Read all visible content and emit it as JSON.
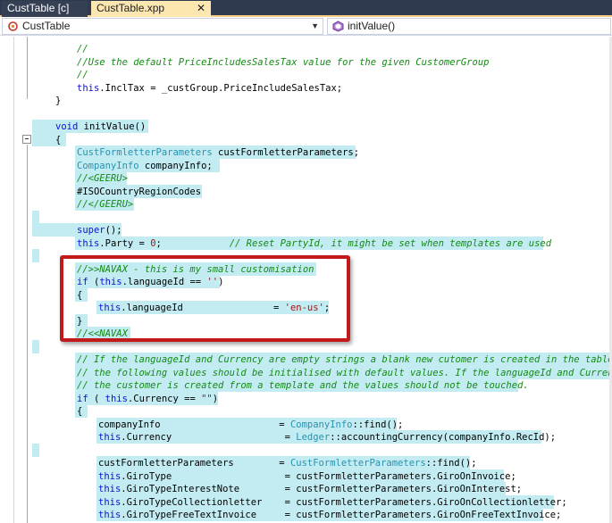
{
  "tabs": [
    {
      "label": "CustTable [c]",
      "active": false
    },
    {
      "label": "CustTable.xpp",
      "active": true,
      "close": "✕"
    }
  ],
  "nav": {
    "class_combo": "CustTable",
    "method_combo": "initValue()",
    "arrow": "▼"
  },
  "colors": {
    "keyword": "#1010d8",
    "comment": "#148a14",
    "type": "#2b91af",
    "string": "#a31515",
    "highlight": "#c2ecf2",
    "annotation_border": "#c21a1a",
    "active_tab": "#fde7b0",
    "tabbar": "#2f3a4f"
  },
  "icons": {
    "class_combo": "class-icon",
    "method_combo": "method-icon",
    "outline_toggle": "collapse-minus-icon"
  },
  "code_lines": [
    [
      {
        "cls": "c",
        "t": "//"
      }
    ],
    [
      {
        "cls": "c",
        "t": "//Use the default PriceIncludesSalesTax value for the given CustomerGroup"
      }
    ],
    [
      {
        "cls": "c",
        "t": "//"
      }
    ],
    [
      {
        "cls": "k",
        "t": "this"
      },
      {
        "cls": "p",
        "t": ".InclTax = _custGroup.PriceIncludeSalesTax;"
      }
    ],
    [
      {
        "cls": "p",
        "t": "}"
      }
    ],
    [
      {
        "cls": "p",
        "t": ""
      }
    ],
    [
      {
        "cls": "k",
        "t": "void"
      },
      {
        "cls": "p",
        "t": " initValue()"
      }
    ],
    [
      {
        "cls": "p",
        "t": "{"
      }
    ],
    [
      {
        "cls": "t",
        "t": "CustFormletterParameters"
      },
      {
        "cls": "p",
        "t": " custFormletterParameters;"
      }
    ],
    [
      {
        "cls": "t",
        "t": "CompanyInfo"
      },
      {
        "cls": "p",
        "t": " companyInfo;"
      }
    ],
    [
      {
        "cls": "c",
        "t": "//<GEERU>"
      }
    ],
    [
      {
        "cls": "p",
        "t": "#ISOCountryRegionCodes"
      }
    ],
    [
      {
        "cls": "c",
        "t": "//</GEERU>"
      }
    ],
    [
      {
        "cls": "p",
        "t": ""
      }
    ],
    [
      {
        "cls": "k",
        "t": "super"
      },
      {
        "cls": "p",
        "t": "();"
      }
    ],
    [
      {
        "cls": "k",
        "t": "this"
      },
      {
        "cls": "p",
        "t": ".Party = "
      },
      {
        "cls": "n",
        "t": "0"
      },
      {
        "cls": "p",
        "t": ";            "
      },
      {
        "cls": "c",
        "t": "// Reset PartyId, it might be set when templates are used"
      }
    ],
    [
      {
        "cls": "p",
        "t": ""
      }
    ],
    [
      {
        "cls": "c",
        "t": "//>>NAVAX - this is my small customisation"
      }
    ],
    [
      {
        "cls": "k",
        "t": "if"
      },
      {
        "cls": "p",
        "t": " ("
      },
      {
        "cls": "k",
        "t": "this"
      },
      {
        "cls": "p",
        "t": ".languageId == "
      },
      {
        "cls": "s",
        "t": "''"
      },
      {
        "cls": "p",
        "t": ")"
      }
    ],
    [
      {
        "cls": "p",
        "t": "{"
      }
    ],
    [
      {
        "cls": "k",
        "t": "this"
      },
      {
        "cls": "p",
        "t": ".languageId                = "
      },
      {
        "cls": "s",
        "t": "'en-us'"
      },
      {
        "cls": "p",
        "t": ";"
      }
    ],
    [
      {
        "cls": "p",
        "t": "}"
      }
    ],
    [
      {
        "cls": "c",
        "t": "//<<NAVAX"
      }
    ],
    [
      {
        "cls": "p",
        "t": ""
      }
    ],
    [
      {
        "cls": "c",
        "t": "// If the languageId and Currency are empty strings a blank new cutomer is created in the table a"
      }
    ],
    [
      {
        "cls": "c",
        "t": "// the following values should be initialised with default values. If the languageId and Currency"
      }
    ],
    [
      {
        "cls": "c",
        "t": "// the customer is created from a template and the values should not be touched."
      }
    ],
    [
      {
        "cls": "k",
        "t": "if"
      },
      {
        "cls": "p",
        "t": " ( "
      },
      {
        "cls": "k",
        "t": "this"
      },
      {
        "cls": "p",
        "t": ".Currency == "
      },
      {
        "cls": "s",
        "t": "\"\""
      },
      {
        "cls": "p",
        "t": ")"
      }
    ],
    [
      {
        "cls": "p",
        "t": "{"
      }
    ],
    [
      {
        "cls": "p",
        "t": "companyInfo                     = "
      },
      {
        "cls": "t",
        "t": "CompanyInfo"
      },
      {
        "cls": "p",
        "t": "::find();"
      }
    ],
    [
      {
        "cls": "k",
        "t": "this"
      },
      {
        "cls": "p",
        "t": ".Currency                    = "
      },
      {
        "cls": "t",
        "t": "Ledger"
      },
      {
        "cls": "p",
        "t": "::accountingCurrency(companyInfo.RecId);"
      }
    ],
    [
      {
        "cls": "p",
        "t": ""
      }
    ],
    [
      {
        "cls": "p",
        "t": "custFormletterParameters        = "
      },
      {
        "cls": "t",
        "t": "CustFormletterParameters"
      },
      {
        "cls": "p",
        "t": "::find();"
      }
    ],
    [
      {
        "cls": "k",
        "t": "this"
      },
      {
        "cls": "p",
        "t": ".GiroType                    = custFormletterParameters.GiroOnInvoice;"
      }
    ],
    [
      {
        "cls": "k",
        "t": "this"
      },
      {
        "cls": "p",
        "t": ".GiroTypeInterestNote        = custFormletterParameters.GiroOnInterest;"
      }
    ],
    [
      {
        "cls": "k",
        "t": "this"
      },
      {
        "cls": "p",
        "t": ".GiroTypeCollectionletter    = custFormletterParameters.GiroOnCollectionletter;"
      }
    ],
    [
      {
        "cls": "k",
        "t": "this"
      },
      {
        "cls": "p",
        "t": ".GiroTypeFreeTextInvoice     = custFormletterParameters.GiroOnFreeTextInvoice;"
      }
    ]
  ]
}
